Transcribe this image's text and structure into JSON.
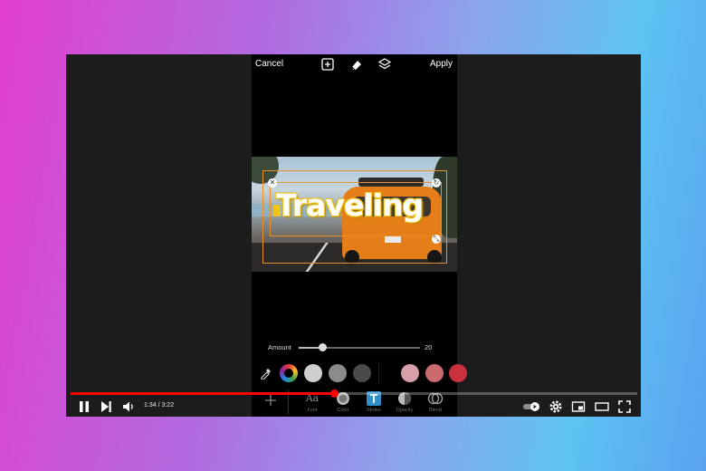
{
  "editor": {
    "cancel_label": "Cancel",
    "apply_label": "Apply",
    "toolbar_icons": [
      "add-layer-icon",
      "eraser-icon",
      "layers-icon"
    ],
    "overlay_text": "Traveling",
    "amount_label": "Amount",
    "amount_value": "20",
    "amount_fraction": 0.2,
    "swatches": [
      "#cfcfcf",
      "#8b8b8b",
      "#494949",
      "#d7a0a8",
      "#c96a6e",
      "#c9313e"
    ],
    "tools": [
      {
        "label": "Font",
        "icon": "font-icon"
      },
      {
        "label": "Color",
        "icon": "color-icon"
      },
      {
        "label": "Stroke",
        "icon": "stroke-icon"
      },
      {
        "label": "Opacity",
        "icon": "opacity-icon"
      },
      {
        "label": "Blend",
        "icon": "blend-icon"
      }
    ],
    "accent": "#e8902a"
  },
  "player": {
    "time": "1:34 / 3:22",
    "progress_fraction": 0.465,
    "colors": {
      "progress": "#ff0000",
      "background": "#1c1c1c"
    }
  }
}
